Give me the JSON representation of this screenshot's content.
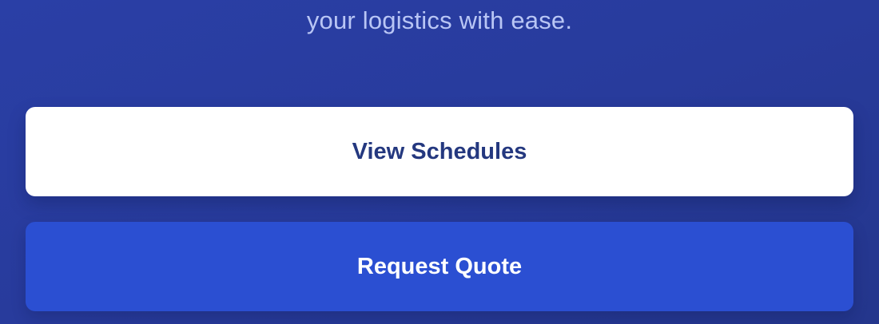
{
  "hero": {
    "subtitle": "your logistics with ease."
  },
  "actions": {
    "view_schedules_label": "View Schedules",
    "request_quote_label": "Request Quote"
  },
  "colors": {
    "background": "#283b9c",
    "subtitle_text": "#b9c6f5",
    "primary_button_bg": "#ffffff",
    "primary_button_text": "#24387f",
    "secondary_button_bg": "#2b4fd2",
    "secondary_button_text": "#ffffff"
  }
}
